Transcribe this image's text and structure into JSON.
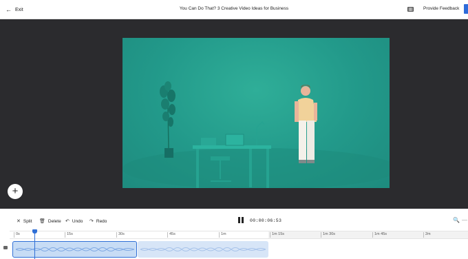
{
  "header": {
    "exit_label": "Exit",
    "title": "You Can Do That? 3 Creative Video Ideas for Business",
    "feedback_label": "Provide Feedback"
  },
  "toolbar": {
    "split_label": "Split",
    "delete_label": "Delete",
    "undo_label": "Undo",
    "redo_label": "Redo",
    "timecode": "00:00:06:53",
    "icons": {
      "split": "scissors-icon",
      "delete": "trash-icon",
      "undo": "undo-icon",
      "redo": "redo-icon",
      "play_state": "pause-icon",
      "zoom": "zoom-icon"
    }
  },
  "timeline": {
    "ticks": [
      "0s",
      "15s",
      "30s",
      "45s",
      "1m",
      "1m 15s",
      "1m 30s",
      "1m 45s",
      "2m"
    ]
  },
  "colors": {
    "accent": "#2f6fd6",
    "stage_bg": "#2b2b2e",
    "video_bg": "#22998a",
    "selected_clip": "#c7dcf5"
  }
}
